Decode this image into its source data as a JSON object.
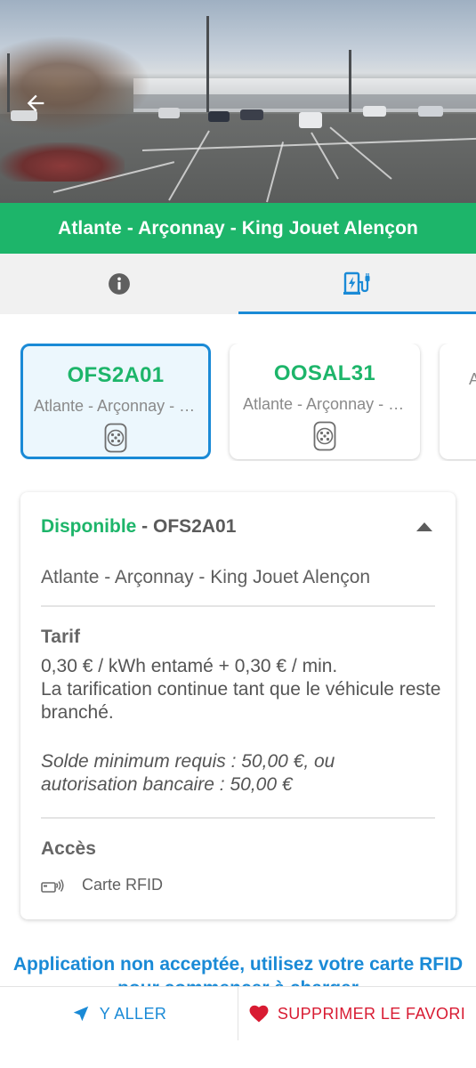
{
  "header": {
    "station_title": "Atlante - Arçonnay - King Jouet Alençon"
  },
  "tabs": [
    {
      "icon": "info-circle-icon",
      "active": false
    },
    {
      "icon": "ev-charger-icon",
      "active": true
    }
  ],
  "charge_points": [
    {
      "code": "OFS2A01",
      "address": "Atlante - Arçonnay - King Jouet Alençon",
      "plug_icon": "type2-plug-icon",
      "selected": true
    },
    {
      "code": "OOSAL31",
      "address": "Atlante - Arçonnay - King Jouet Alençon",
      "plug_icon": "type2-plug-icon",
      "selected": false
    },
    {
      "code": "",
      "address": "Atlante - Arçonnay - King Jouet Alençon",
      "plug_icon": "type2-plug-icon",
      "selected": false
    }
  ],
  "detail": {
    "status": "Disponible",
    "separator": " - ",
    "code": "OFS2A01",
    "address": "Atlante - Arçonnay - King Jouet Alençon",
    "tarif_title": "Tarif",
    "tarif_line1": "0,30 € / kWh entamé + 0,30 € / min.",
    "tarif_line2": "La tarification continue tant que le véhicule reste branché.",
    "solde_text": "Solde minimum requis : 50,00 €, ou autorisation bancaire : 50,00 €",
    "access_title": "Accès",
    "access_item": "Carte RFID"
  },
  "warning": "Application non acceptée, utilisez votre carte RFID pour commencer à charger",
  "bottom_bar": {
    "go_label": "Y ALLER",
    "fav_label": "SUPPRIMER LE FAVORI"
  },
  "colors": {
    "green": "#1db56a",
    "blue": "#1a8ad6",
    "red": "#d81b32"
  }
}
